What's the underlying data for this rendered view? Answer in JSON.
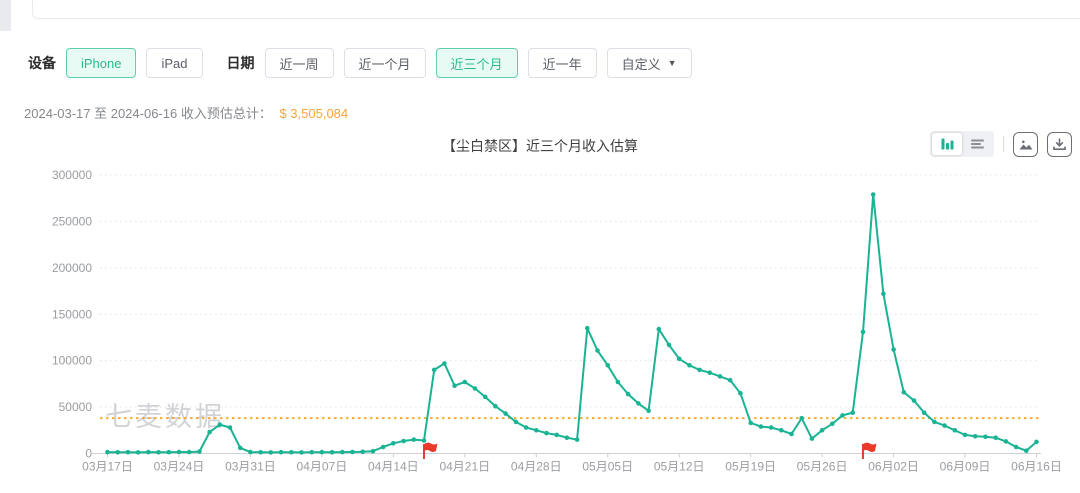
{
  "watermark": "七麦数据",
  "filters": {
    "device_label": "设备",
    "device_options": [
      {
        "label": "iPhone",
        "active": true
      },
      {
        "label": "iPad",
        "active": false
      }
    ],
    "date_label": "日期",
    "date_options": [
      {
        "label": "近一周",
        "active": false
      },
      {
        "label": "近一个月",
        "active": false
      },
      {
        "label": "近三个月",
        "active": true
      },
      {
        "label": "近一年",
        "active": false
      },
      {
        "label": "自定义",
        "active": false,
        "has_dropdown": true
      }
    ],
    "caret_glyph": "▼",
    "active_color": "#2bb98f",
    "active_bg": "#e7faf3"
  },
  "summary": {
    "range_text": "2024-03-17 至 2024-06-16 收入预估总计：",
    "total": "$ 3,505,084",
    "total_color": "#f9a43b"
  },
  "chart_header": {
    "controls": [
      {
        "name": "bar-chart-view-toggle",
        "active": true
      },
      {
        "name": "table-view-toggle",
        "active": false
      },
      {
        "name": "export-image-button",
        "active": false
      },
      {
        "name": "download-data-button",
        "active": false
      }
    ]
  },
  "chart_data": {
    "type": "line",
    "title": "【尘白禁区】近三个月收入估算",
    "ylim": [
      0,
      300000
    ],
    "y_ticks": [
      0,
      50000,
      100000,
      150000,
      200000,
      250000,
      300000
    ],
    "x_tick_labels": [
      "03月17日",
      "03月24日",
      "03月31日",
      "04月07日",
      "04月14日",
      "04月21日",
      "04月28日",
      "05月05日",
      "05月12日",
      "05月19日",
      "05月26日",
      "06月02日",
      "06月09日",
      "06月16日"
    ],
    "x_tick_every_days": 7,
    "grid": "horizontal-dotted",
    "legend": "none",
    "line_color": "#1ab394",
    "average_line": {
      "value": 38100,
      "color": "#f5a623",
      "style": "dotted"
    },
    "flag_markers": {
      "color": "#e8392b",
      "dates": [
        "04-17",
        "05-30"
      ]
    },
    "series": [
      {
        "name": "收入预估",
        "dates": [
          "03-17",
          "03-18",
          "03-19",
          "03-20",
          "03-21",
          "03-22",
          "03-23",
          "03-24",
          "03-25",
          "03-26",
          "03-27",
          "03-28",
          "03-29",
          "03-30",
          "03-31",
          "04-01",
          "04-02",
          "04-03",
          "04-04",
          "04-05",
          "04-06",
          "04-07",
          "04-08",
          "04-09",
          "04-10",
          "04-11",
          "04-12",
          "04-13",
          "04-14",
          "04-15",
          "04-16",
          "04-17",
          "04-18",
          "04-19",
          "04-20",
          "04-21",
          "04-22",
          "04-23",
          "04-24",
          "04-25",
          "04-26",
          "04-27",
          "04-28",
          "04-29",
          "04-30",
          "05-01",
          "05-02",
          "05-03",
          "05-04",
          "05-05",
          "05-06",
          "05-07",
          "05-08",
          "05-09",
          "05-10",
          "05-11",
          "05-12",
          "05-13",
          "05-14",
          "05-15",
          "05-16",
          "05-17",
          "05-18",
          "05-19",
          "05-20",
          "05-21",
          "05-22",
          "05-23",
          "05-24",
          "05-25",
          "05-26",
          "05-27",
          "05-28",
          "05-29",
          "05-30",
          "05-31",
          "06-01",
          "06-02",
          "06-03",
          "06-04",
          "06-05",
          "06-06",
          "06-07",
          "06-08",
          "06-09",
          "06-10",
          "06-11",
          "06-12",
          "06-13",
          "06-14",
          "06-15",
          "06-16"
        ],
        "values": [
          1500,
          1300,
          1400,
          1200,
          1500,
          1300,
          1400,
          1600,
          1500,
          2000,
          23000,
          31000,
          28000,
          6000,
          1500,
          1300,
          1200,
          1400,
          1300,
          1200,
          1400,
          1500,
          1300,
          1500,
          1600,
          1800,
          2500,
          7000,
          11000,
          13500,
          15000,
          14000,
          90000,
          97000,
          73000,
          77000,
          70000,
          61000,
          51000,
          43000,
          34000,
          28000,
          25000,
          22000,
          20000,
          17000,
          15000,
          135000,
          111000,
          95000,
          77000,
          64000,
          54000,
          46000,
          134000,
          117000,
          102000,
          95000,
          90000,
          87000,
          83000,
          79000,
          65000,
          33000,
          29000,
          28000,
          25000,
          21000,
          38000,
          16000,
          25000,
          32000,
          41000,
          44000,
          131000,
          279000,
          172000,
          112000,
          66000,
          57000,
          44000,
          34000,
          30000,
          25000,
          20000,
          18500,
          18000,
          17000,
          13000,
          7000,
          3000,
          12500
        ]
      }
    ]
  }
}
